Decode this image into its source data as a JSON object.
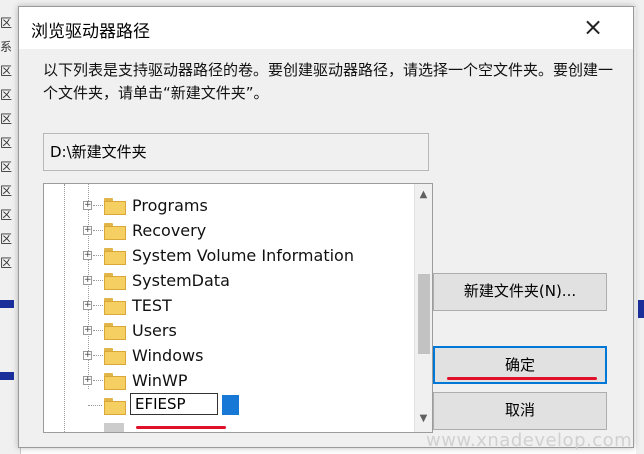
{
  "dialog": {
    "title": "浏览驱动器路径",
    "close_label": "×",
    "instruction": "以下列表是支持驱动器路径的卷。要创建驱动器路径，请选择一个空文件夹。要创建一个文件夹，请单击“新建文件夹”。",
    "path": "D:\\新建文件夹"
  },
  "tree": {
    "items": [
      {
        "label": "Programs"
      },
      {
        "label": "Recovery"
      },
      {
        "label": "System Volume Information"
      },
      {
        "label": "SystemData"
      },
      {
        "label": "TEST"
      },
      {
        "label": "Users"
      },
      {
        "label": "Windows"
      },
      {
        "label": "WinWP"
      }
    ],
    "edit_value": "EFIESP",
    "expander_glyph": "+"
  },
  "buttons": {
    "new_folder": "新建文件夹(N)...",
    "ok": "确定",
    "cancel": "取消"
  },
  "background": {
    "left_rows": [
      "区",
      "系统",
      "区",
      "区",
      "区",
      "区",
      "区",
      "区",
      "区",
      "区",
      "区"
    ]
  },
  "watermark": "www.xnadevelop.com",
  "colors": {
    "accent": "#0078d7",
    "annotation_red": "#e0102a",
    "folder": "#f5cf62"
  }
}
